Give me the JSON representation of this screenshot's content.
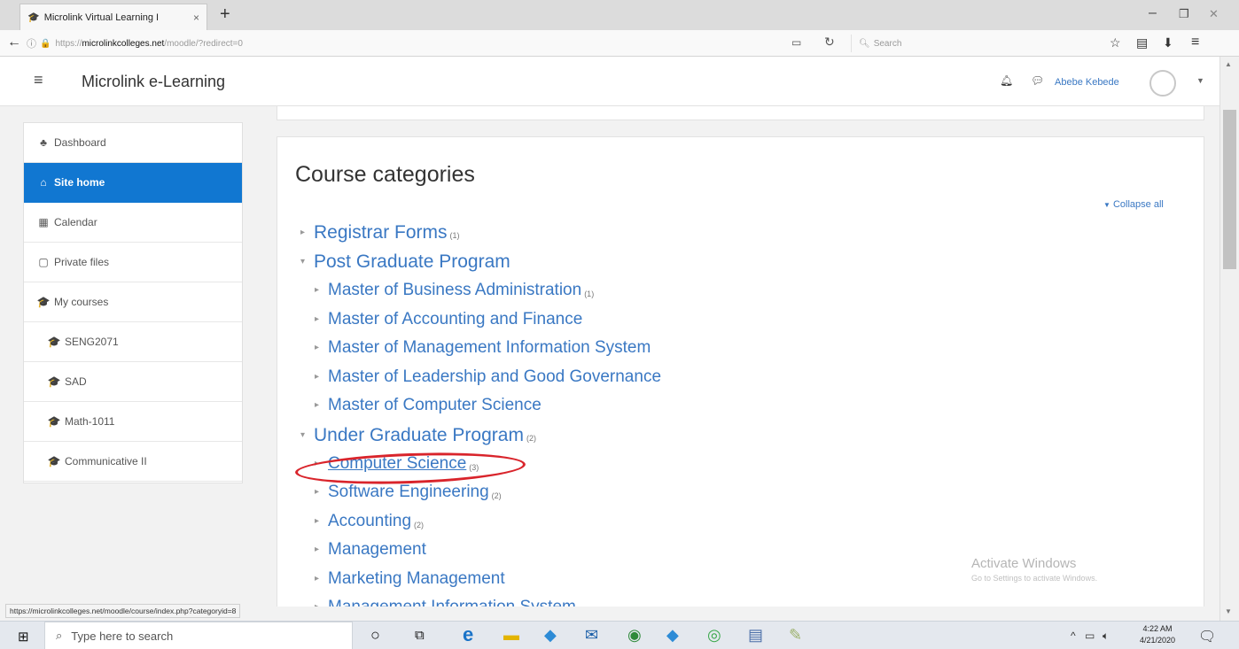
{
  "browser": {
    "tab_title": "Microlink Virtual Learning I",
    "tab_close": "×",
    "new_tab": "+",
    "url_prefix": "https://",
    "url_host": "microlinkcolleges.net",
    "url_path": "/moodle/?redirect=0",
    "search_placeholder": "Search",
    "win_min": "–",
    "win_max": "❐",
    "win_close": "✕"
  },
  "header": {
    "site_name": "Microlink e-Learning",
    "user_name": "Abebe Kebede"
  },
  "sidebar": {
    "items": [
      {
        "label": "Dashboard",
        "icon": "♣",
        "active": false,
        "sub": false
      },
      {
        "label": "Site home",
        "icon": "⌂",
        "active": true,
        "sub": false
      },
      {
        "label": "Calendar",
        "icon": "▦",
        "active": false,
        "sub": false
      },
      {
        "label": "Private files",
        "icon": "▢",
        "active": false,
        "sub": false
      },
      {
        "label": "My courses",
        "icon": "🎓",
        "active": false,
        "sub": false
      },
      {
        "label": "SENG2071",
        "icon": "🎓",
        "active": false,
        "sub": true
      },
      {
        "label": "SAD",
        "icon": "🎓",
        "active": false,
        "sub": true
      },
      {
        "label": "Math-1011",
        "icon": "🎓",
        "active": false,
        "sub": true
      },
      {
        "label": "Communicative II",
        "icon": "🎓",
        "active": false,
        "sub": true
      }
    ]
  },
  "main": {
    "title": "Course categories",
    "collapse_all": "Collapse all",
    "categories": [
      {
        "label": "Registrar Forms",
        "count": "(1)",
        "level": 0,
        "expanded": false
      },
      {
        "label": "Post Graduate Program",
        "count": "",
        "level": 0,
        "expanded": true
      },
      {
        "label": "Master of Business Administration",
        "count": "(1)",
        "level": 1,
        "expanded": false
      },
      {
        "label": "Master of Accounting and Finance",
        "count": "",
        "level": 1,
        "expanded": false
      },
      {
        "label": "Master of Management Information System",
        "count": "",
        "level": 1,
        "expanded": false
      },
      {
        "label": "Master of Leadership and Good Governance",
        "count": "",
        "level": 1,
        "expanded": false
      },
      {
        "label": "Master of Computer Science",
        "count": "",
        "level": 1,
        "expanded": false
      },
      {
        "label": "Under Graduate Program",
        "count": "(2)",
        "level": 0,
        "expanded": true
      },
      {
        "label": "Computer Science",
        "count": "(3)",
        "level": 1,
        "expanded": false
      },
      {
        "label": "Software Engineering",
        "count": "(2)",
        "level": 1,
        "expanded": false
      },
      {
        "label": "Accounting",
        "count": "(2)",
        "level": 1,
        "expanded": false
      },
      {
        "label": "Management",
        "count": "",
        "level": 1,
        "expanded": false
      },
      {
        "label": "Marketing Management",
        "count": "",
        "level": 1,
        "expanded": false
      },
      {
        "label": "Management Information System",
        "count": "",
        "level": 1,
        "expanded": false
      }
    ]
  },
  "watermark": {
    "line1": "Activate Windows",
    "line2": "Go to Settings to activate Windows."
  },
  "status_url": "https://microlinkcolleges.net/moodle/course/index.php?categoryid=8",
  "taskbar": {
    "search_placeholder": "Type here to search",
    "time": "4:22 AM",
    "date": "4/21/2020"
  },
  "colors": {
    "accent": "#1177d1",
    "link": "#3a78c3",
    "annotation": "#d9242b"
  }
}
